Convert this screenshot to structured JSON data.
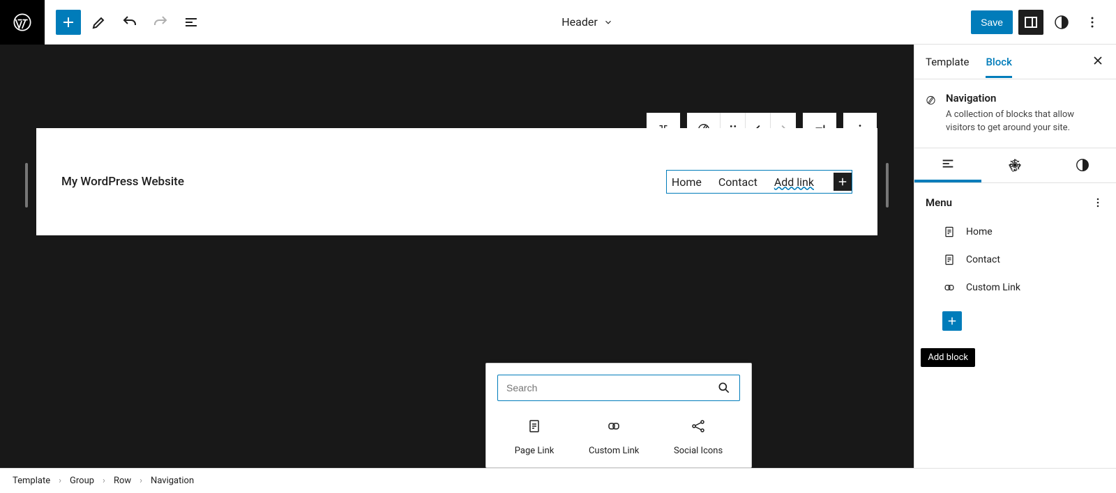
{
  "topbar": {
    "template_name": "Header",
    "save_label": "Save"
  },
  "canvas": {
    "site_title": "My WordPress Website",
    "nav": {
      "home": "Home",
      "contact": "Contact",
      "add_link": "Add link"
    }
  },
  "sidebar": {
    "tabs": {
      "template": "Template",
      "block": "Block"
    },
    "block_title": "Navigation",
    "block_desc": "A collection of blocks that allow visitors to get around your site.",
    "menu_label": "Menu",
    "menu_items": {
      "home": "Home",
      "contact": "Contact",
      "custom": "Custom Link"
    }
  },
  "tooltip": {
    "add_block": "Add block"
  },
  "inserter": {
    "search_placeholder": "Search",
    "items": {
      "page_link": "Page Link",
      "custom_link": "Custom Link",
      "social_icons": "Social Icons"
    }
  },
  "breadcrumb": {
    "template": "Template",
    "group": "Group",
    "row": "Row",
    "navigation": "Navigation"
  }
}
